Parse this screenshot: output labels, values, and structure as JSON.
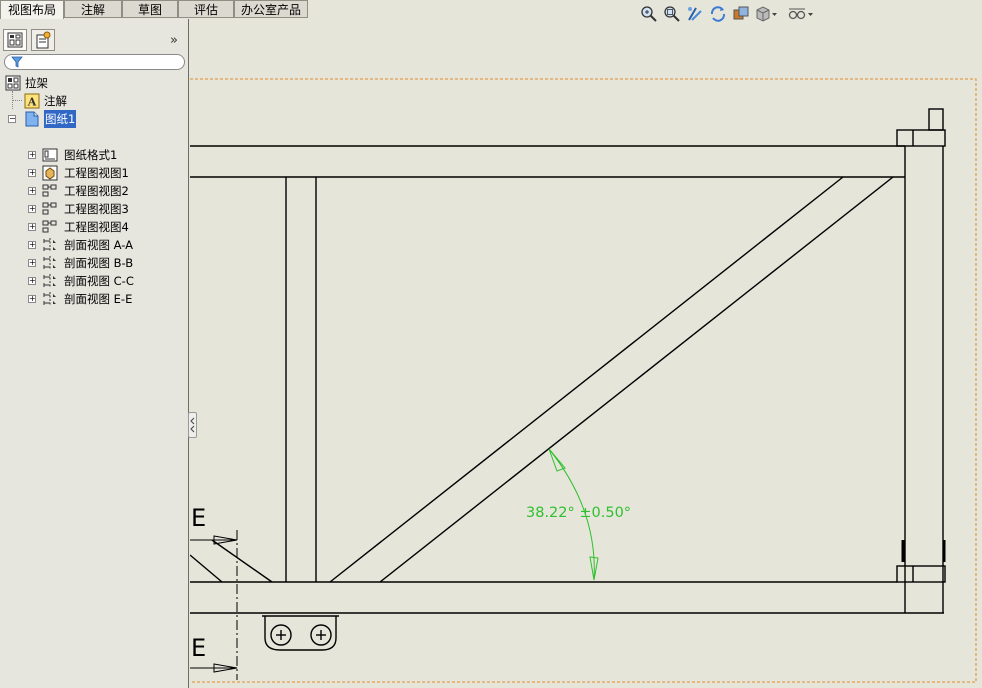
{
  "tabs": [
    "视图布局",
    "注解",
    "草图",
    "评估",
    "办公室产品"
  ],
  "active_tab": 0,
  "toolbar_icons": [
    "zoom-to-fit-icon",
    "zoom-area-icon",
    "previous-view-icon",
    "rebuild-icon",
    "display-style-icon",
    "view-orientation-icon",
    "hide-show-icon"
  ],
  "feature_tree": {
    "root": "拉架",
    "annotations": "注解",
    "sheet": "图纸1",
    "items": [
      "图纸格式1",
      "工程图视图1",
      "工程图视图2",
      "工程图视图3",
      "工程图视图4",
      "剖面视图 A-A",
      "剖面视图 B-B",
      "剖面视图 C-C",
      "剖面视图 E-E"
    ]
  },
  "drawing": {
    "angle_dimension": "38.22° ±0.50°",
    "section_label_top": "E",
    "section_label_bottom": "E",
    "dimension_color": "#2ec02e",
    "line_color": "#000000",
    "border_color": "#e08a2a"
  }
}
